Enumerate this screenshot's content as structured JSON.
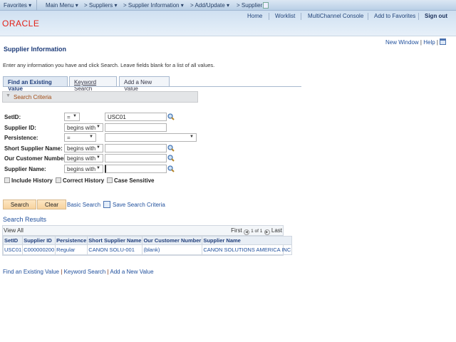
{
  "nav": {
    "favorites": "Favorites",
    "main_menu": "Main Menu",
    "crumbs": [
      "Suppliers",
      "Supplier Information",
      "Add/Update",
      "Supplier"
    ]
  },
  "header": {
    "links": [
      "Home",
      "Worklist",
      "MultiChannel Console",
      "Add to Favorites"
    ],
    "sign_out": "Sign out",
    "logo": "ORACLE"
  },
  "page_links": {
    "new_window": "New Window",
    "help": "Help"
  },
  "page": {
    "title": "Supplier Information",
    "instructions": "Enter any information you have and click Search. Leave fields blank for a list of all values."
  },
  "tabs": [
    "Find an Existing Value",
    "Keyword Search",
    "Add a New Value"
  ],
  "criteria": {
    "header": "Search Criteria",
    "fields": [
      {
        "label": "SetID:",
        "operator": "=",
        "value": "USC01"
      },
      {
        "label": "Supplier ID:",
        "operator": "begins with",
        "value": ""
      },
      {
        "label": "Persistence:",
        "operator": "=",
        "value": ""
      },
      {
        "label": "Short Supplier Name:",
        "operator": "begins with",
        "value": ""
      },
      {
        "label": "Our Customer Number:",
        "operator": "begins with",
        "value": ""
      },
      {
        "label": "Supplier Name:",
        "operator": "begins with",
        "value": ""
      }
    ],
    "checkboxes": [
      {
        "label": "Include History",
        "checked": false
      },
      {
        "label": "Correct History",
        "checked": false
      },
      {
        "label": "Case Sensitive",
        "checked": false
      }
    ]
  },
  "buttons": {
    "search": "Search",
    "clear": "Clear",
    "basic_search": "Basic Search",
    "save_criteria": "Save Search Criteria"
  },
  "results": {
    "title": "Search Results",
    "view_all": "View All",
    "first": "First",
    "page": "1 of 1",
    "last": "Last",
    "columns": [
      "SetID",
      "Supplier ID",
      "Persistence",
      "Short Supplier Name",
      "Our Customer Number",
      "Supplier Name"
    ],
    "rows": [
      [
        "USC01",
        "C000000200",
        "Regular",
        "CANON SOLU-001",
        "(blank)",
        "CANON SOLUTIONS AMERICA INC"
      ]
    ]
  },
  "footer_links": [
    "Find an Existing Value",
    "Keyword Search",
    "Add a New Value"
  ],
  "colors": {
    "accent": "#1f4f9c",
    "oracle_red": "#e2231a",
    "button": "#f7d39e"
  }
}
